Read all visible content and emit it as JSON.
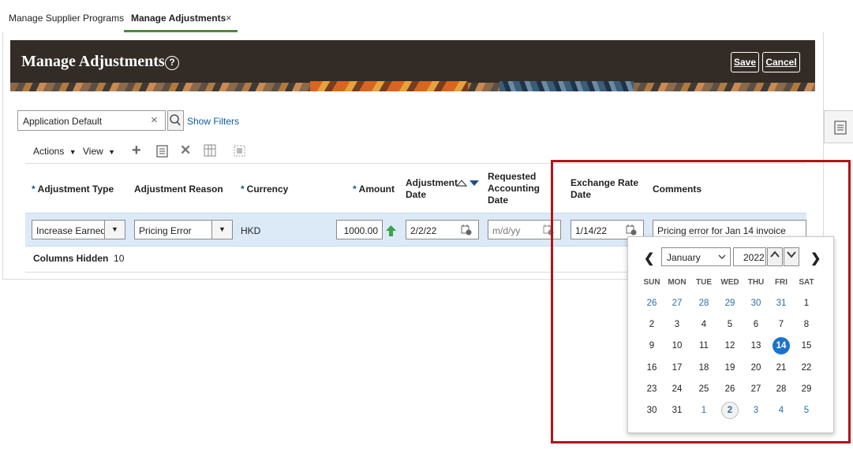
{
  "tabs": [
    {
      "label": "Manage Supplier Programs",
      "active": false
    },
    {
      "label": "Manage Adjustments",
      "active": true,
      "close": "×"
    }
  ],
  "header": {
    "title": "Manage Adjustments",
    "help": "?",
    "save_label": "Save",
    "cancel_label": "Cancel"
  },
  "search": {
    "value": "Application Default",
    "clear": "×",
    "show_filters": "Show Filters"
  },
  "toolbar": {
    "actions_label": "Actions",
    "view_label": "View",
    "menu_arrow": "▼",
    "add": "+",
    "delete": "✕"
  },
  "table": {
    "required_mark": "*",
    "columns": {
      "adjustment_type": "Adjustment Type",
      "adjustment_reason": "Adjustment Reason",
      "currency": "Currency",
      "amount": "Amount",
      "adjustment_date_1": "Adjustment",
      "adjustment_date_2": "Date",
      "requested_accounting_date_1": "Requested",
      "requested_accounting_date_2": "Accounting",
      "requested_accounting_date_3": "Date",
      "exchange_rate_date_1": "Exchange Rate",
      "exchange_rate_date_2": "Date",
      "comments": "Comments"
    },
    "row": {
      "adjustment_type": "Increase Earned",
      "adjustment_reason": "Pricing Error",
      "currency": "HKD",
      "amount": "1000.00",
      "adjustment_date": "2/2/22",
      "requested_accounting_date_placeholder": "m/d/yy",
      "exchange_rate_date": "1/14/22",
      "comments": "Pricing error for Jan 14 invoice"
    },
    "columns_hidden_label": "Columns Hidden",
    "columns_hidden_count": "10"
  },
  "calendar": {
    "month": "January",
    "year": "2022",
    "prev": "❮",
    "next": "❯",
    "weekdays": [
      "SUN",
      "MON",
      "TUE",
      "WED",
      "THU",
      "FRI",
      "SAT"
    ],
    "weeks": [
      [
        "26",
        "27",
        "28",
        "29",
        "30",
        "31",
        "1"
      ],
      [
        "2",
        "3",
        "4",
        "5",
        "6",
        "7",
        "8"
      ],
      [
        "9",
        "10",
        "11",
        "12",
        "13",
        "14",
        "15"
      ],
      [
        "16",
        "17",
        "18",
        "19",
        "20",
        "21",
        "22"
      ],
      [
        "23",
        "24",
        "25",
        "26",
        "27",
        "28",
        "29"
      ],
      [
        "30",
        "31",
        "1",
        "2",
        "3",
        "4",
        "5"
      ]
    ],
    "selected_day": "14",
    "today_day": "2",
    "accent_color": "#1a73c9"
  },
  "colors": {
    "header_bg": "#332c26",
    "link": "#0b5c9e",
    "row_highlight": "#dbeaf6",
    "annotation_border": "#b0141b",
    "tab_underline": "#4e8a3d"
  }
}
